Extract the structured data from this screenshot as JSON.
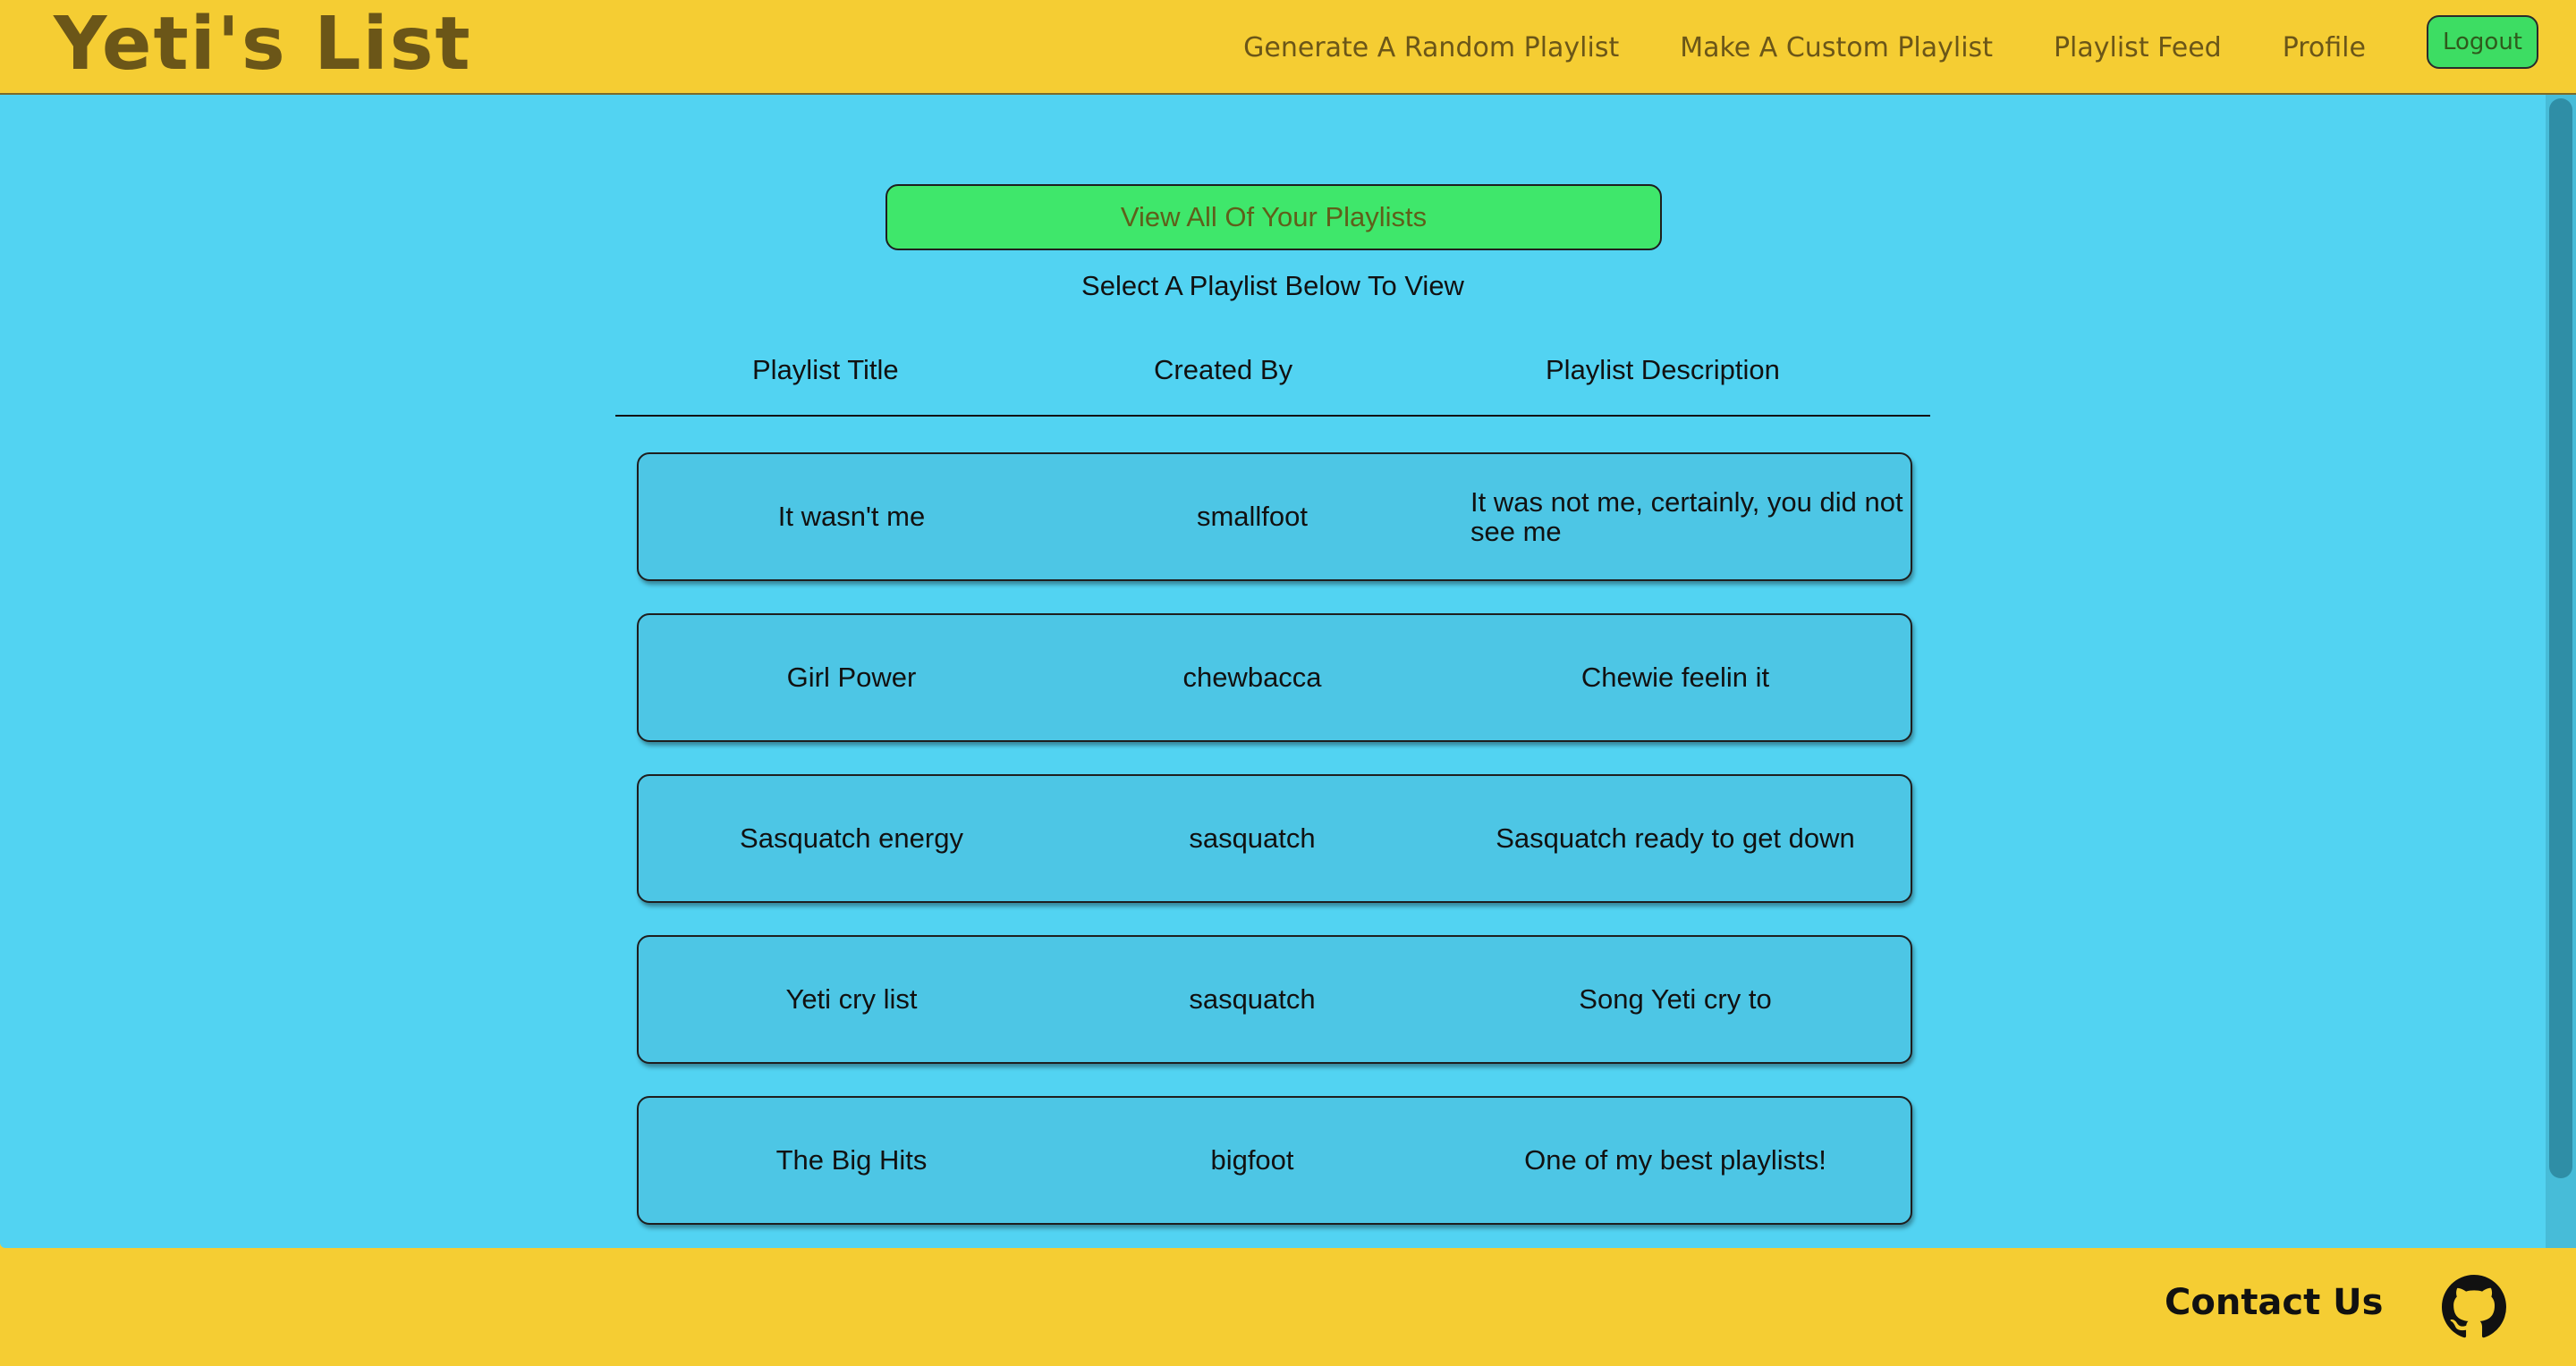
{
  "brand": {
    "title": "Yeti's List"
  },
  "nav": {
    "links": [
      "Generate A Random Playlist",
      "Make A Custom Playlist",
      "Playlist Feed",
      "Profile"
    ],
    "logout_label": "Logout"
  },
  "main": {
    "view_all_label": "View All Of Your Playlists",
    "subtitle": "Select A Playlist Below To View",
    "columns": [
      "Playlist Title",
      "Created By",
      "Playlist Description"
    ],
    "playlists": [
      {
        "title": "It wasn't me",
        "creator": "smallfoot",
        "description": "It was not me, certainly, you did not see me"
      },
      {
        "title": "Girl Power",
        "creator": "chewbacca",
        "description": "Chewie feelin it"
      },
      {
        "title": "Sasquatch energy",
        "creator": "sasquatch",
        "description": "Sasquatch ready to get down"
      },
      {
        "title": "Yeti cry list",
        "creator": "sasquatch",
        "description": "Song Yeti cry to"
      },
      {
        "title": "The Big Hits",
        "creator": "bigfoot",
        "description": "One of my best playlists!"
      }
    ]
  },
  "footer": {
    "contact_label": "Contact Us",
    "github_icon": "github-icon"
  },
  "colors": {
    "header_bg": "#f5cd33",
    "main_bg": "#52d3f2",
    "button_green": "#3fe76b",
    "row_bg": "#4dc6e5"
  }
}
